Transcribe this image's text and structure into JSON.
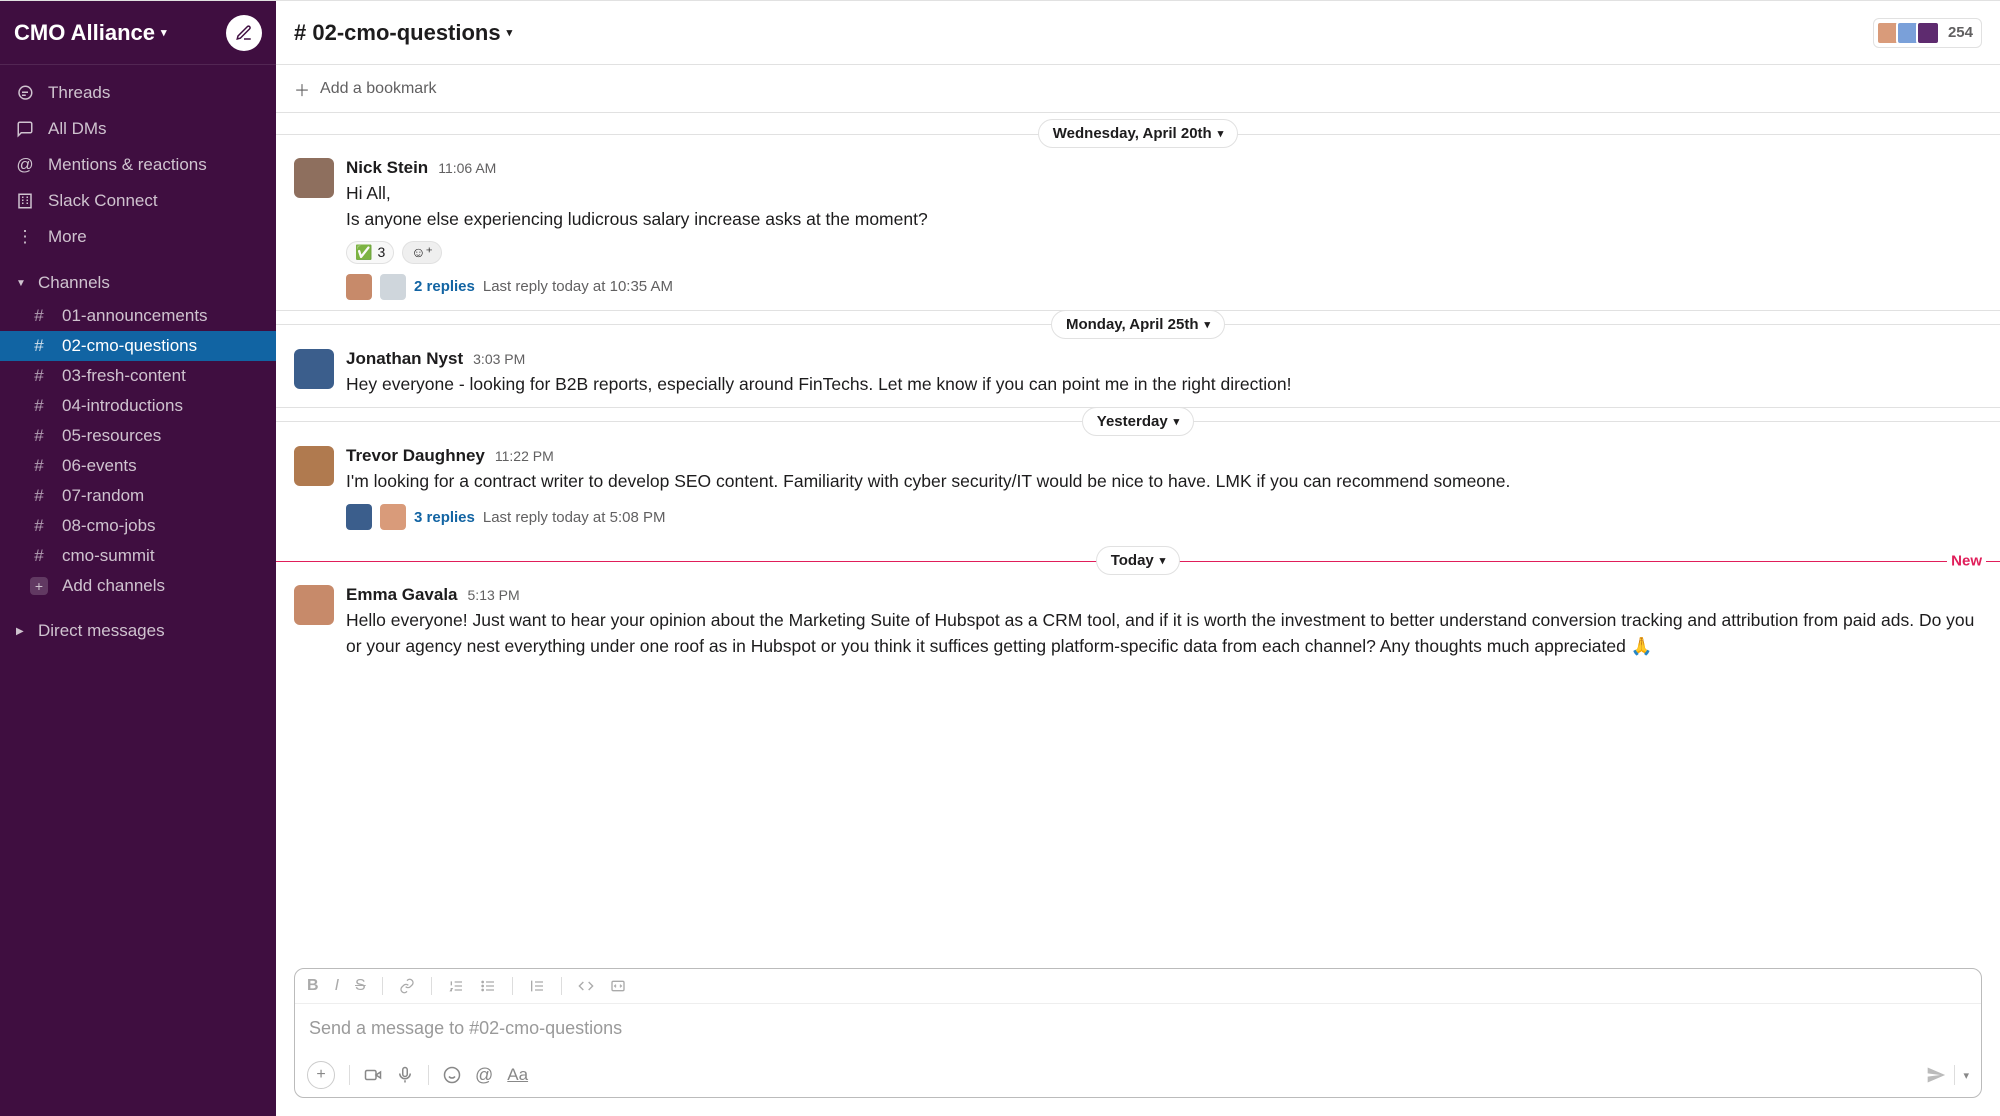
{
  "sidebar": {
    "workspace": "CMO Alliance",
    "nav": {
      "threads": "Threads",
      "alldms": "All DMs",
      "mentions": "Mentions & reactions",
      "connect": "Slack Connect",
      "more": "More"
    },
    "channels_label": "Channels",
    "channels": [
      {
        "name": "01-announcements"
      },
      {
        "name": "02-cmo-questions"
      },
      {
        "name": "03-fresh-content"
      },
      {
        "name": "04-introductions"
      },
      {
        "name": "05-resources"
      },
      {
        "name": "06-events"
      },
      {
        "name": "07-random"
      },
      {
        "name": "08-cmo-jobs"
      },
      {
        "name": "cmo-summit"
      }
    ],
    "add_channels": "Add channels",
    "dms_label": "Direct messages"
  },
  "header": {
    "channel": "# 02-cmo-questions",
    "member_count": "254",
    "bookmark": "Add a bookmark"
  },
  "separators": {
    "s1": "Wednesday, April 20th",
    "s2": "Monday, April 25th",
    "s3": "Yesterday",
    "s4": "Today",
    "new": "New"
  },
  "messages": {
    "m1": {
      "author": "Nick Stein",
      "time": "11:06 AM",
      "line1": "Hi All,",
      "line2": "Is anyone else experiencing ludicrous salary increase asks at the moment?",
      "react_count": "3",
      "replies": "2 replies",
      "last": "Last reply today at 10:35 AM"
    },
    "m2": {
      "author": "Jonathan Nyst",
      "time": "3:03 PM",
      "text": "Hey everyone - looking for B2B reports, especially around FinTechs. Let me know if you can point me in the right direction!"
    },
    "m3": {
      "author": "Trevor Daughney",
      "time": "11:22 PM",
      "text": "I'm looking for a contract writer to develop SEO content. Familiarity with cyber security/IT would be nice to have. LMK if you can recommend someone.",
      "replies": "3 replies",
      "last": "Last reply today at 5:08 PM"
    },
    "m4": {
      "author": "Emma Gavala",
      "time": "5:13 PM",
      "text": "Hello everyone! Just want to hear your opinion about the Marketing Suite of Hubspot as a CRM tool, and if it is worth the investment to better understand conversion tracking and attribution from paid ads. Do you or your agency nest everything under one roof as in Hubspot or you think it suffices getting platform-specific data from each channel? Any thoughts much appreciated 🙏"
    }
  },
  "composer": {
    "placeholder": "Send a message to #02-cmo-questions"
  }
}
